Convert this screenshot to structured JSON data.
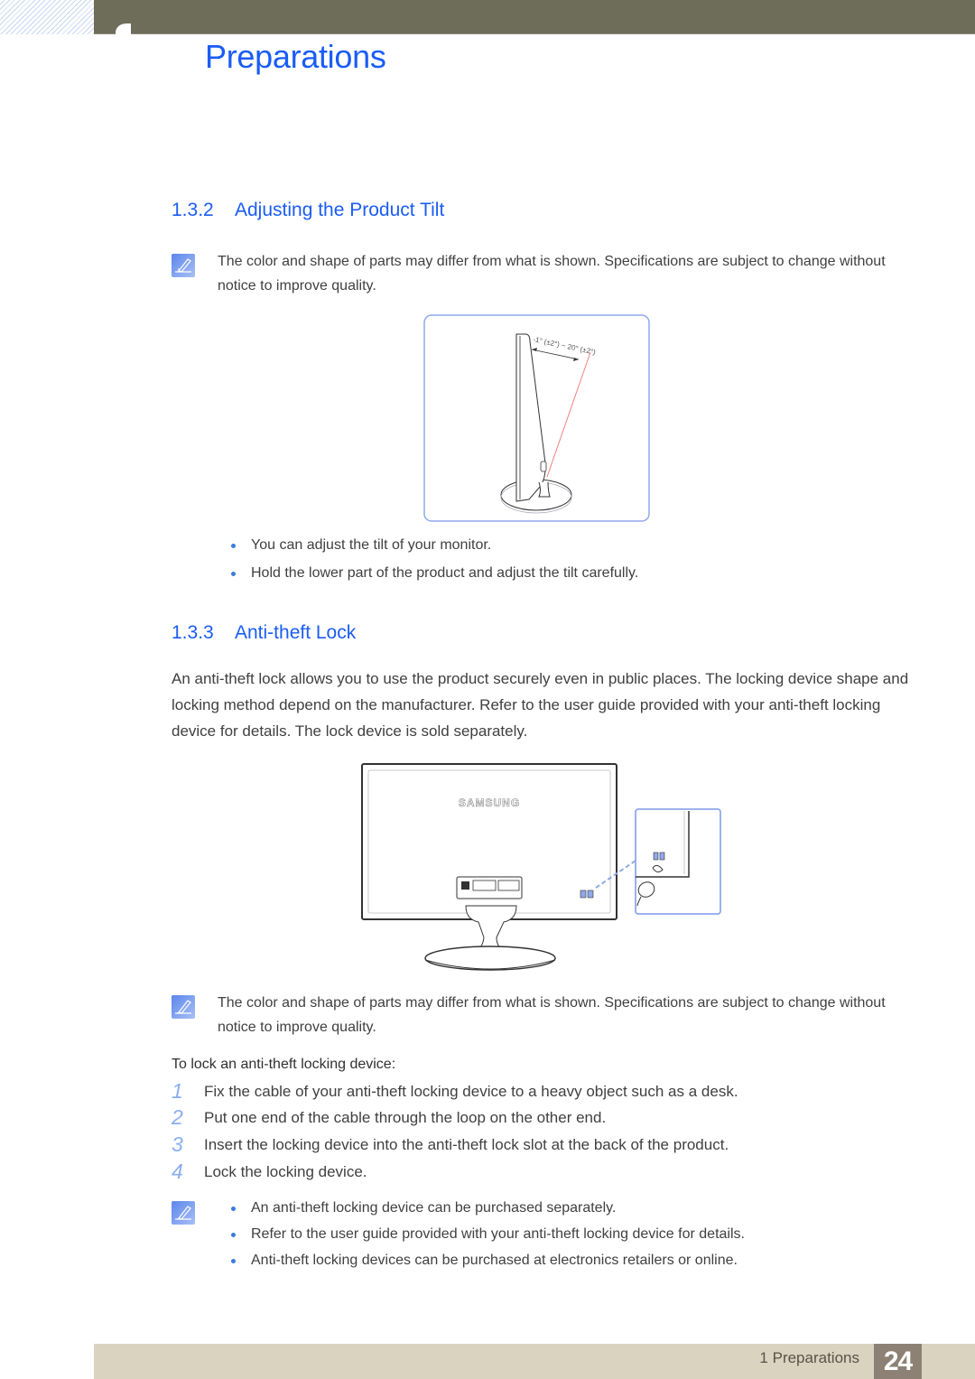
{
  "header": {
    "chapter_title": "Preparations"
  },
  "sections": [
    {
      "number": "1.3.2",
      "title": "Adjusting the Product Tilt",
      "note": "The color and shape of parts may differ from what is shown. Specifications are subject to change without notice to improve quality.",
      "figure": {
        "angle_label": "-1° (±2°) ~ 20° (±2°)"
      },
      "bullets": [
        "You can adjust the tilt of your monitor.",
        "Hold the lower part of the product and adjust the tilt carefully."
      ]
    },
    {
      "number": "1.3.3",
      "title": "Anti-theft Lock",
      "paragraph": "An anti-theft lock allows you to use the product securely even in public places. The locking device shape and locking method depend on the manufacturer. Refer to the user guide provided with your anti-theft locking device for details. The lock device is sold separately.",
      "figure": {
        "brand_label": "SAMSUNG"
      },
      "note": "The color and shape of parts may differ from what is shown. Specifications are subject to change without notice to improve quality.",
      "procedure_title": "To lock an anti-theft locking device:",
      "steps": [
        {
          "n": "1",
          "text": "Fix the cable of your anti-theft locking device to a heavy object such as a desk."
        },
        {
          "n": "2",
          "text": "Put one end of the cable through the loop on the other end."
        },
        {
          "n": "3",
          "text": "Insert the locking device into the anti-theft lock slot at the back of the product."
        },
        {
          "n": "4",
          "text": "Lock the locking device."
        }
      ],
      "note_bullets": [
        "An anti-theft locking device can be purchased separately.",
        "Refer to the user guide provided with your anti-theft locking device for details.",
        "Anti-theft locking devices can be purchased at electronics retailers or online."
      ]
    }
  ],
  "footer": {
    "label": "1 Preparations",
    "page_number": "24"
  },
  "colors": {
    "accent_blue": "#1a5cf5",
    "header_bar": "#6e6d5a",
    "footer_bar": "#d9d3c0",
    "page_box": "#8d8175"
  }
}
